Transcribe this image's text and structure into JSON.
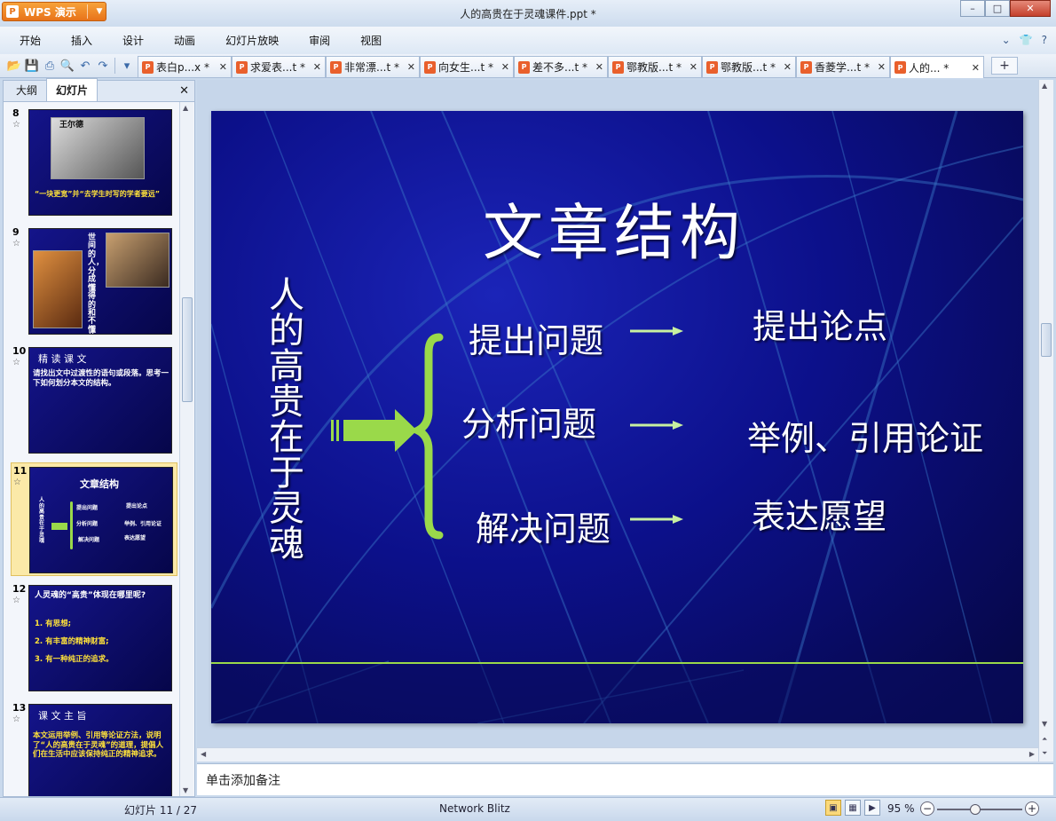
{
  "app": {
    "button_label": "WPS 演示",
    "logo_glyph": "P",
    "document_title": "人的高贵在于灵魂课件.ppt *",
    "window_controls": {
      "minimize": "–",
      "maximize": "□",
      "close": "✕"
    }
  },
  "menu": {
    "items": [
      "开始",
      "插入",
      "设计",
      "动画",
      "幻灯片放映",
      "审阅",
      "视图"
    ],
    "right_icons": [
      "chevron-down-icon",
      "shirt-icon",
      "help-icon"
    ]
  },
  "toolbar": {
    "icons": [
      "open-folder-icon",
      "save-icon",
      "print-icon",
      "print-preview-icon",
      "undo-icon",
      "redo-icon",
      "customize-icon"
    ],
    "tabs": [
      {
        "label": "表白p...x *",
        "active": false
      },
      {
        "label": "求爱表...t *",
        "active": false
      },
      {
        "label": "非常漂...t *",
        "active": false
      },
      {
        "label": "向女生...t *",
        "active": false
      },
      {
        "label": "差不多...t *",
        "active": false
      },
      {
        "label": "鄂教版...t *",
        "active": false
      },
      {
        "label": "鄂教版...t *",
        "active": false
      },
      {
        "label": "香菱学...t *",
        "active": false
      },
      {
        "label": "人的... *",
        "active": true
      }
    ],
    "tab_add_label": "+"
  },
  "left_panel": {
    "tabs": [
      "大纲",
      "幻灯片"
    ],
    "active_tab": "幻灯片",
    "thumbnails": [
      {
        "number": "8",
        "title": "王尔德",
        "caption": "“一块更宽”并“去学生时写的学者要远”"
      },
      {
        "number": "9",
        "vertical_text": "世间的人，分成懂得的和不懂的"
      },
      {
        "number": "10",
        "title": "精 读 课 文",
        "body": "请找出文中过渡性的语句或段落。思考一下如何划分本文的结构。"
      },
      {
        "number": "11",
        "title": "文章结构",
        "selected": true
      },
      {
        "number": "12",
        "body": "人灵魂的“高贵”体现在哪里呢?",
        "items": [
          "1. 有思想;",
          "2. 有丰富的精神财富;",
          "3. 有一种纯正的追求。"
        ]
      },
      {
        "number": "13",
        "title": "课 文 主 旨",
        "body": "本文运用举例、引用等论证方法，说明了“人的高贵在于灵魂”的道理，提倡人们在生活中应该保持纯正的精神追求。"
      }
    ]
  },
  "slide": {
    "title": "文章结构",
    "vertical_title": "人的高贵在于灵魂",
    "stages": [
      "提出问题",
      "分析问题",
      "解决问题"
    ],
    "points": [
      "提出论点",
      "举例、引用论证",
      "表达愿望"
    ],
    "colors": {
      "background": "#0c108a",
      "accent": "#9ad94a",
      "text": "#ffffff"
    }
  },
  "notes": {
    "placeholder": "单击添加备注"
  },
  "status": {
    "slide_info": "幻灯片 11 / 27",
    "theme": "Network Blitz",
    "zoom": "95 %",
    "zoom_level": 0.45,
    "view_icons": [
      "normal-view-icon",
      "slide-sorter-icon",
      "slideshow-icon"
    ]
  }
}
